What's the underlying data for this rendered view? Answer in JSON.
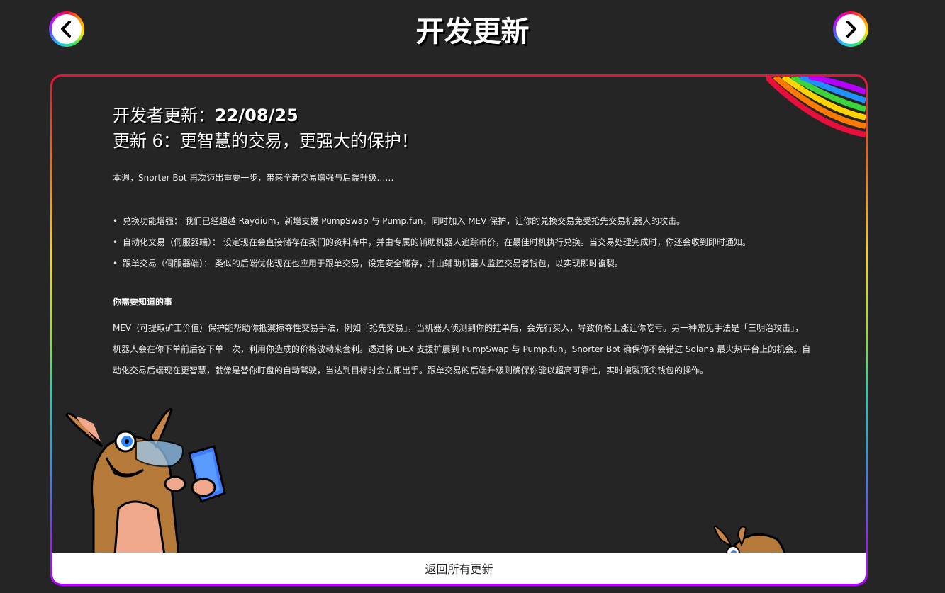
{
  "header": {
    "title": "开发更新",
    "prev_icon": "chevron-left-icon",
    "next_icon": "chevron-right-icon"
  },
  "post": {
    "dev_label": "开发者更新：",
    "date": "22/08/25",
    "update_title": "更新 6：更智慧的交易，更强大的保护！",
    "intro": "本週，Snorter Bot 再次迈出重要一步，带来全新交易增强与后端升级……",
    "bullets": [
      "兑换功能增强： 我们已经超越 Raydium，新增支援 PumpSwap 与 Pump.fun，同时加入 MEV 保护，让你的兑换交易免受抢先交易机器人的攻击。",
      "自动化交易（伺服器端）： 设定现在会直接储存在我们的资料库中，并由专属的辅助机器人追踪币价，在最佳时机执行兑换。当交易处理完成时，你还会收到即时通知。",
      "跟单交易（伺服器端）： 类似的后端优化现在也应用于跟单交易，设定安全储存，并由辅助机器人监控交易者钱包，以实现即时複製。"
    ],
    "section_heading": "你需要知道的事",
    "body": "MEV（可提取矿工价值）保护能帮助你抵禦掠夺性交易手法，例如「抢先交易」，当机器人侦测到你的挂单后，会先行买入，导致价格上涨让你吃亏。另一种常见手法是「三明治攻击」，机器人会在你下单前后各下单一次，利用你造成的价格波动来套利。透过将 DEX 支援扩展到 PumpSwap 与 Pump.fun，Snorter Bot 确保你不会错过 Solana 最火热平台上的机会。自动化交易后端现在更智慧，就像是替你盯盘的自动驾驶，当达到目标时会立即出手。跟单交易的后端升级则确保你能以超高可靠性，实时複製顶尖钱包的操作。"
  },
  "footer": {
    "back_label": "返回所有更新"
  },
  "colors": {
    "background": "#252525",
    "card_border_top": "#e8103a",
    "card_border_bottom": "#b400ff",
    "footer_bg": "#ffffff"
  }
}
